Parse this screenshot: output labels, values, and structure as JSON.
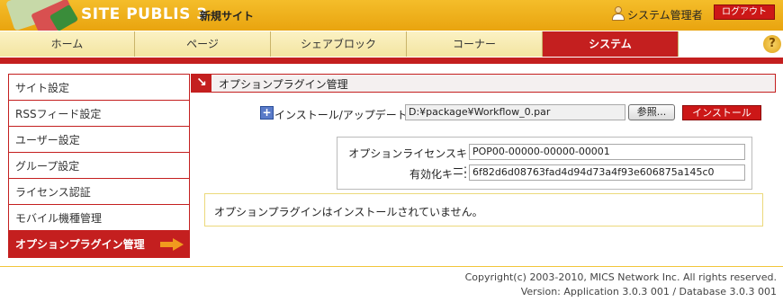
{
  "header": {
    "logo_text": "SITE PUBLIS 3",
    "site_name": "新規サイト",
    "user_name": "システム管理者",
    "logout_label": "ログアウト"
  },
  "nav": {
    "tabs": [
      {
        "label": "ホーム"
      },
      {
        "label": "ページ"
      },
      {
        "label": "シェアブロック"
      },
      {
        "label": "コーナー"
      },
      {
        "label": "システム",
        "active": true
      }
    ],
    "help_icon": "?"
  },
  "sidebar": {
    "items": [
      {
        "label": "サイト設定"
      },
      {
        "label": "RSSフィード設定"
      },
      {
        "label": "ユーザー設定"
      },
      {
        "label": "グループ設定"
      },
      {
        "label": "ライセンス認証"
      },
      {
        "label": "モバイル機種管理"
      },
      {
        "label": "オプションプラグイン管理",
        "active": true
      }
    ]
  },
  "main": {
    "title": "オプションプラグイン管理",
    "install": {
      "label": "インストール/アップデート",
      "file_value": "D:¥package¥Workflow_0.par",
      "browse_label": "参照...",
      "install_button": "インストール"
    },
    "license": {
      "key_label": "オプションライセンスキー:",
      "key_value": "POP00-00000-00000-00001",
      "activation_label": "有効化キー:",
      "activation_value": "6f82d6d08763fad4d94d73a4f93e606875a145c0"
    },
    "message": "オプションプラグインはインストールされていません。"
  },
  "footer": {
    "copyright": "Copyright(c) 2003-2010, MICS Network Inc. All rights reserved.",
    "version": "Version: Application 3.0.3 001  / Database 3.0.3 001"
  },
  "colors": {
    "brand_red": "#c41f1f",
    "header_gold": "#f0b020",
    "nav_cream": "#f7ebb4",
    "arrow_orange": "#f19a1e"
  },
  "icons": {
    "install_icon": "plus-doc-icon",
    "title_icon": "arrow-down-right-icon",
    "user_icon": "user-icon",
    "help_icon": "help-icon",
    "active_arrow": "arrow-right-icon"
  }
}
